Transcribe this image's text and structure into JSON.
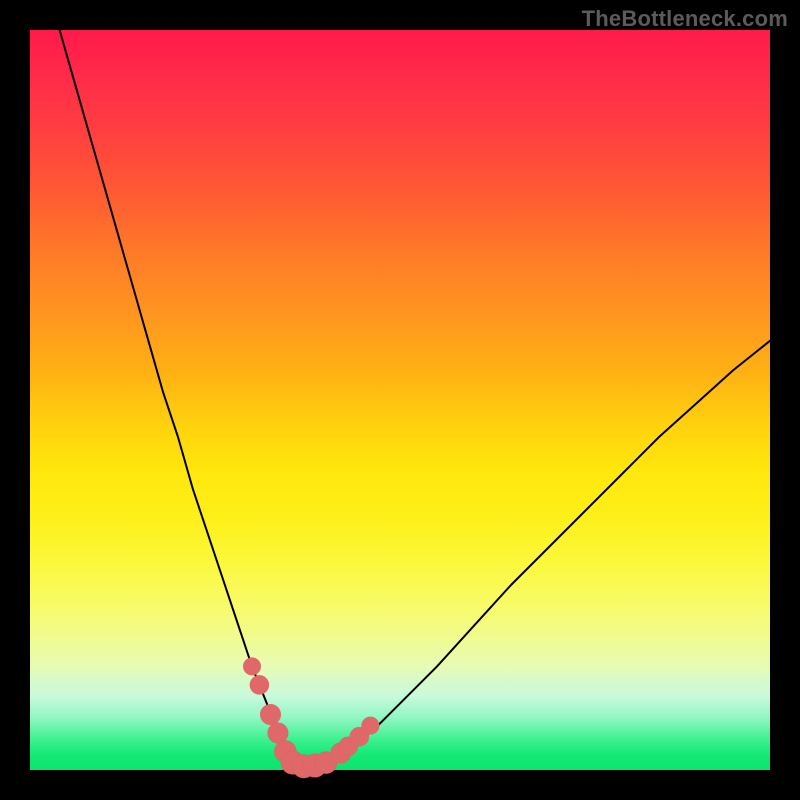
{
  "watermark": "TheBottleneck.com",
  "colors": {
    "frame": "#000000",
    "watermark_text": "#5b5b5b",
    "curve_stroke": "#000000",
    "marker_fill": "#e06868",
    "marker_stroke": "#d15a5a",
    "gradient_top": "#ff1a4a",
    "gradient_bottom": "#0de46f"
  },
  "chart_data": {
    "type": "line",
    "title": "",
    "xlabel": "",
    "ylabel": "",
    "xlim": [
      0,
      100
    ],
    "ylim": [
      0,
      100
    ],
    "grid": false,
    "legend": false,
    "series": [
      {
        "name": "bottleneck-curve",
        "x": [
          4,
          6,
          8,
          10,
          12,
          14,
          16,
          18,
          20,
          22,
          24,
          26,
          28,
          30,
          32,
          33,
          34,
          35,
          36,
          37,
          38,
          40,
          42,
          44,
          47,
          50,
          55,
          60,
          65,
          70,
          75,
          80,
          85,
          90,
          95,
          100
        ],
        "y": [
          100,
          93,
          86,
          79,
          72,
          65,
          58,
          51,
          45,
          38,
          32,
          26,
          20,
          14,
          9,
          6,
          4,
          2,
          1,
          0.5,
          0.5,
          1,
          2,
          3.5,
          6,
          9,
          14,
          19.5,
          25,
          30,
          35,
          40,
          45,
          49.5,
          54,
          58
        ]
      }
    ],
    "markers": [
      {
        "x": 30,
        "y": 14,
        "r": 1.2
      },
      {
        "x": 31,
        "y": 11.5,
        "r": 1.3
      },
      {
        "x": 32.5,
        "y": 7.5,
        "r": 1.4
      },
      {
        "x": 33.5,
        "y": 5,
        "r": 1.4
      },
      {
        "x": 34.5,
        "y": 2.5,
        "r": 1.5
      },
      {
        "x": 35.5,
        "y": 1,
        "r": 1.6
      },
      {
        "x": 37,
        "y": 0.5,
        "r": 1.6
      },
      {
        "x": 38.5,
        "y": 0.6,
        "r": 1.6
      },
      {
        "x": 40,
        "y": 1,
        "r": 1.5
      },
      {
        "x": 42,
        "y": 2.3,
        "r": 1.4
      },
      {
        "x": 43,
        "y": 3.2,
        "r": 1.3
      },
      {
        "x": 44.5,
        "y": 4.5,
        "r": 1.3
      },
      {
        "x": 46,
        "y": 6,
        "r": 1.2
      }
    ],
    "background_gradient_meaning": "Vertical gradient from red (high bottleneck) at top to green (balanced) at bottom; curve height indicates bottleneck severity."
  }
}
